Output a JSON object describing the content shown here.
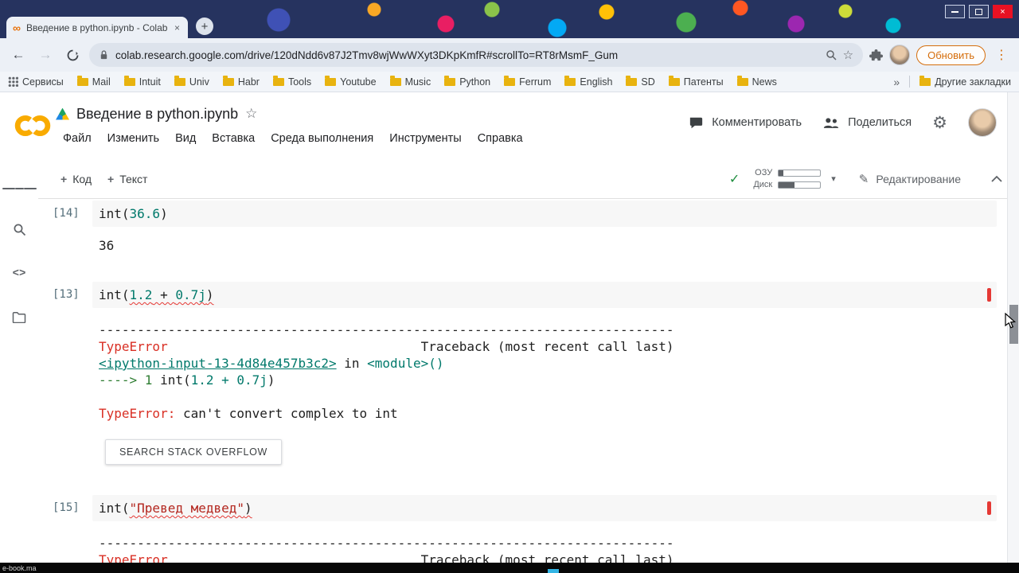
{
  "icons": {
    "back": "←",
    "forward": "→",
    "star": "☆",
    "gear": "⚙",
    "pencil": "✎",
    "caret": "▾",
    "check": "✓",
    "menu_dots": "⋮",
    "overflow": "»",
    "plus": "+",
    "close": "×",
    "infinity": "∞",
    "code": "<>"
  },
  "tab": {
    "title": "Введение в python.ipynb - Colab",
    "new_tab": "+"
  },
  "nav": {
    "url": "colab.research.google.com/drive/120dNdd6v87J2Tmv8wjWwWXyt3DKpKmfR#scrollTo=RT8rMsmF_Gum",
    "update_label": "Обновить"
  },
  "bookmarks": {
    "services": "Сервисы",
    "items": [
      "Mail",
      "Intuit",
      "Univ",
      "Habr",
      "Tools",
      "Youtube",
      "Music",
      "Python",
      "Ferrum",
      "English",
      "SD",
      "Патенты",
      "News"
    ],
    "other": "Другие закладки"
  },
  "header": {
    "title": "Введение в python.ipynb",
    "menu": [
      "Файл",
      "Изменить",
      "Вид",
      "Вставка",
      "Среда выполнения",
      "Инструменты",
      "Справка"
    ],
    "comment": "Комментировать",
    "share": "Поделиться"
  },
  "toolbar": {
    "add_code": "Код",
    "add_text": "Текст",
    "ram": "ОЗУ",
    "disk": "Диск",
    "mode": "Редактирование"
  },
  "cells": {
    "c14": {
      "label": "[14]",
      "p0": "int(",
      "p1": "36.6",
      "p2": ")",
      "out": "36"
    },
    "c13": {
      "label": "[13]",
      "p0": "int(",
      "p1": "1.2",
      "p2": " + ",
      "p3": "0.7j",
      "p4": ")",
      "tb": {
        "rule": "---------------------------------------------------------------------------",
        "err": "TypeError",
        "trace": "                                 Traceback (most recent call last)",
        "link": "<ipython-input-13-4d84e457b3c2>",
        "in": " in ",
        "module": "<module>()",
        "arrow": "----> 1 ",
        "c0": "int(",
        "c1": "1.2 + 0.7j",
        "c2": ")",
        "err2": "TypeError: ",
        "msg": "can't convert complex to int"
      },
      "button": "SEARCH STACK OVERFLOW"
    },
    "c15": {
      "label": "[15]",
      "p0": "int(",
      "p1": "\"Превед медвед\"",
      "p2": ")",
      "tb": {
        "rule": "---------------------------------------------------------------------------",
        "err": "TypeError",
        "trace": "                                 Traceback (most recent call last)"
      }
    }
  },
  "taskbar": {
    "label": "e-book.ma"
  }
}
